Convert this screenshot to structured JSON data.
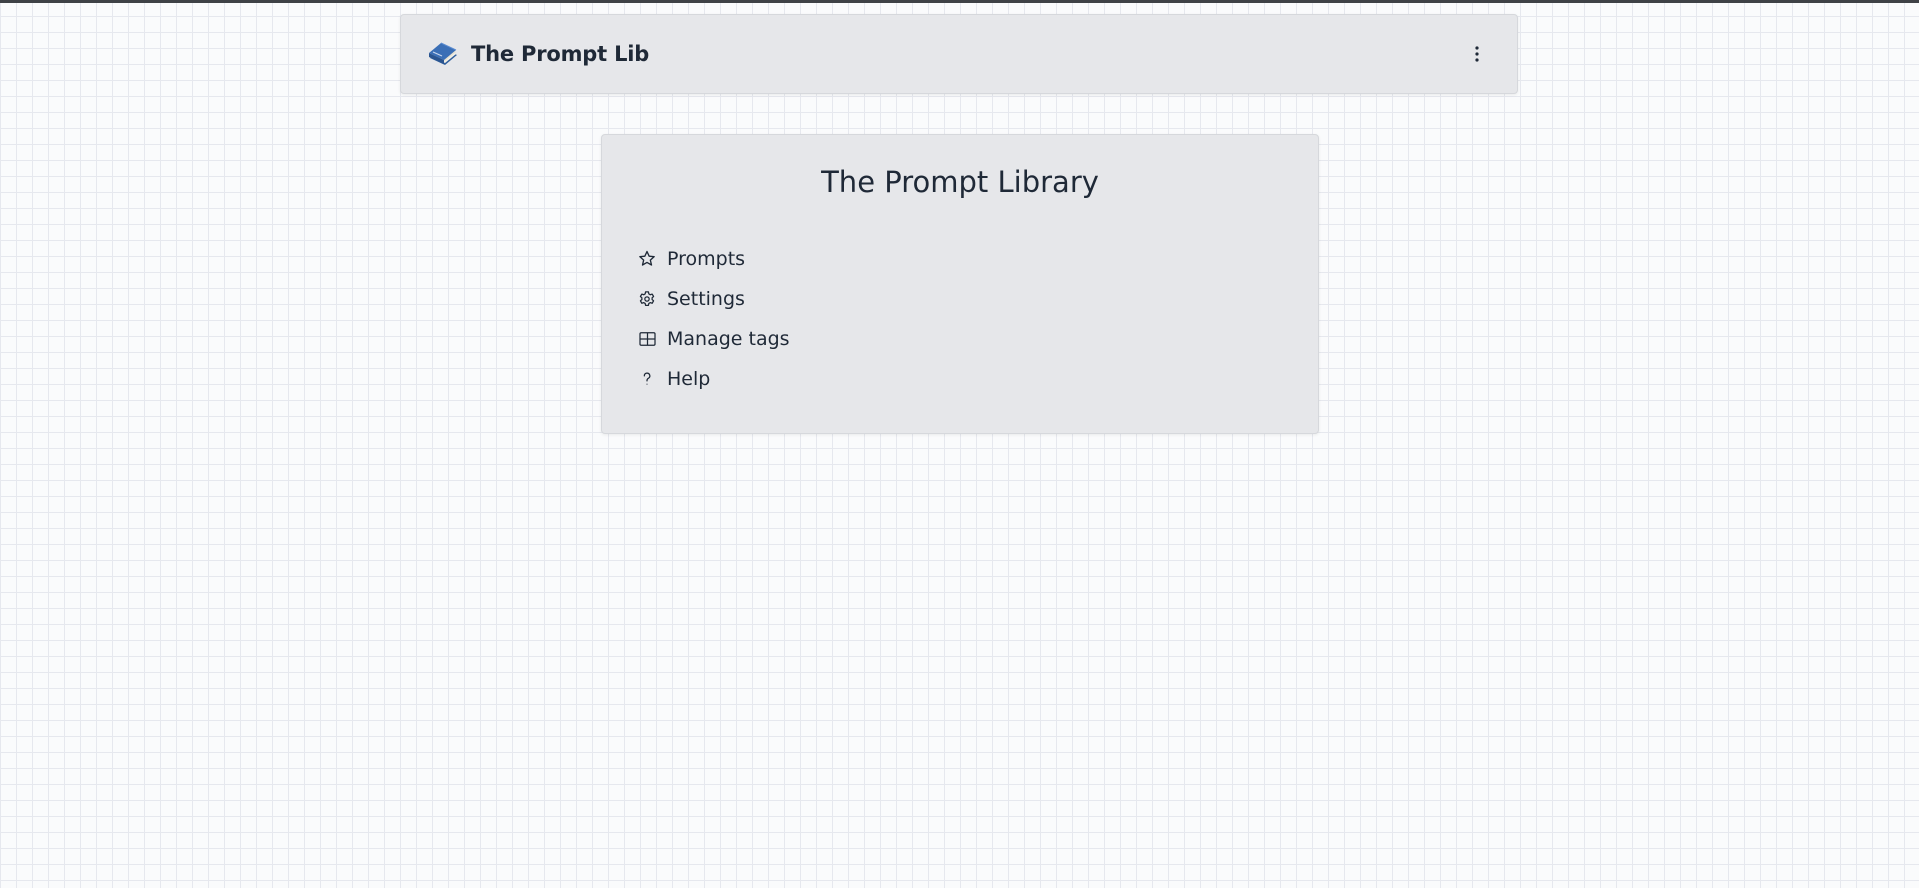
{
  "header": {
    "brand_icon": "book-icon",
    "brand_title": "The Prompt Lib",
    "menu_icon": "more-vertical-icon"
  },
  "card": {
    "title": "The Prompt Library",
    "items": [
      {
        "label": "Prompts",
        "icon": "star-icon"
      },
      {
        "label": "Settings",
        "icon": "gear-icon"
      },
      {
        "label": "Manage tags",
        "icon": "table-icon"
      },
      {
        "label": "Help",
        "icon": "question-icon"
      }
    ]
  },
  "colors": {
    "text": "#1f2937",
    "panel": "#e6e7ea",
    "page_background": "#fafbfc",
    "grid_line": "#e6e8ee",
    "top_strip": "#3f4246",
    "book_blue": "#3b6fb6"
  }
}
